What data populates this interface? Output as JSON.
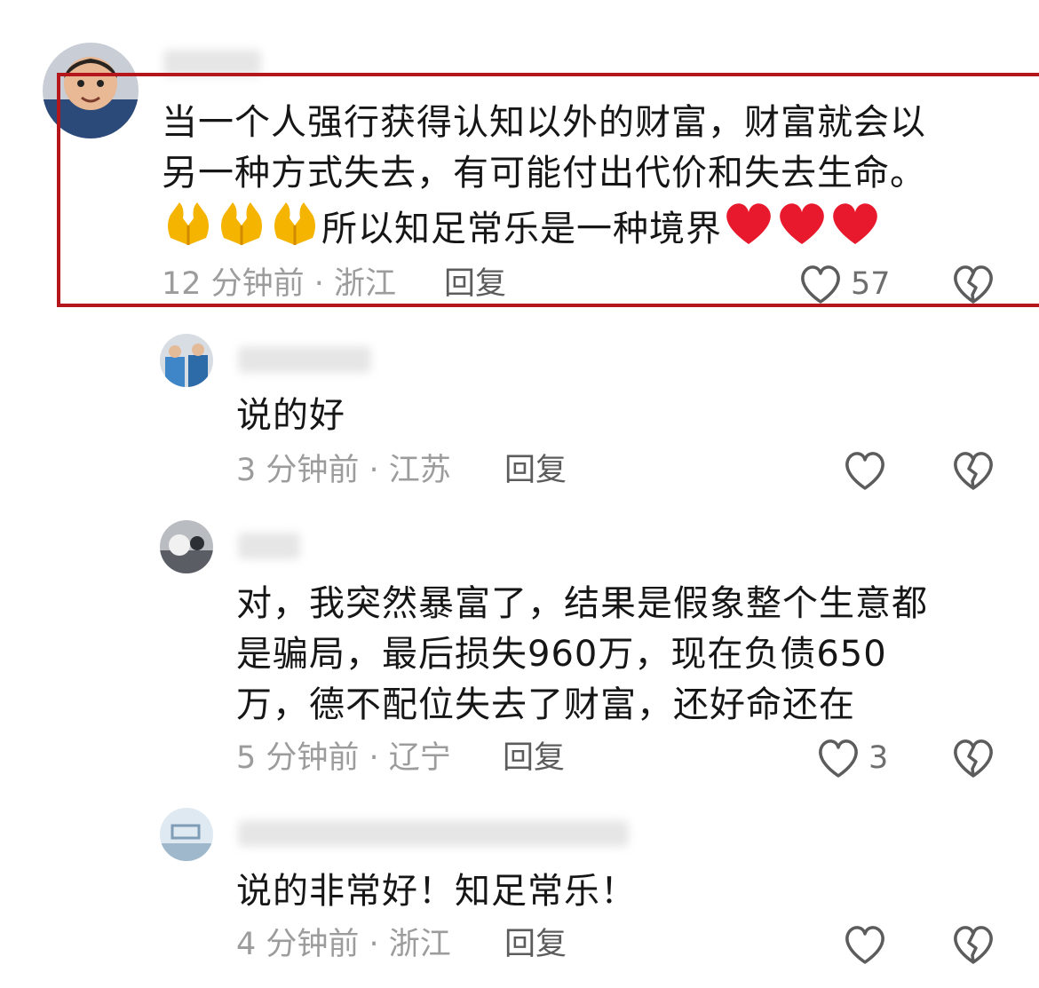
{
  "comments": [
    {
      "text_line1": "当一个人强行获得认知以外的财富，财富就会以",
      "text_line2": "另一种方式失去，有可能付出代价和失去生命。",
      "text_line3": "所以知足常乐是一种境界",
      "prefix_emoji": [
        "folded-hands",
        "folded-hands",
        "folded-hands"
      ],
      "suffix_emoji": [
        "red-heart",
        "red-heart",
        "red-heart"
      ],
      "time": "12 分钟前 · 浙江",
      "reply_label": "回复",
      "likes": "57",
      "highlighted": true
    },
    {
      "text": "说的好",
      "time": "3 分钟前 · 江苏",
      "reply_label": "回复",
      "likes": ""
    },
    {
      "text_line1": "对，我突然暴富了，结果是假象整个生意都",
      "text_line2": "是骗局，最后损失960万，现在负债650",
      "text_line3": "万，德不配位失去了财富，还好命还在",
      "time": "5 分钟前 · 辽宁",
      "reply_label": "回复",
      "likes": "3"
    },
    {
      "text": "说的非常好！知足常乐！",
      "time": "4 分钟前 · 浙江",
      "reply_label": "回复",
      "likes": ""
    }
  ],
  "icons": {
    "like": "heart-outline-icon",
    "dislike": "broken-heart-outline-icon"
  },
  "colors": {
    "highlight_border": "#b4161b",
    "meta_text": "#9c9c9c",
    "body_text": "#161616"
  }
}
